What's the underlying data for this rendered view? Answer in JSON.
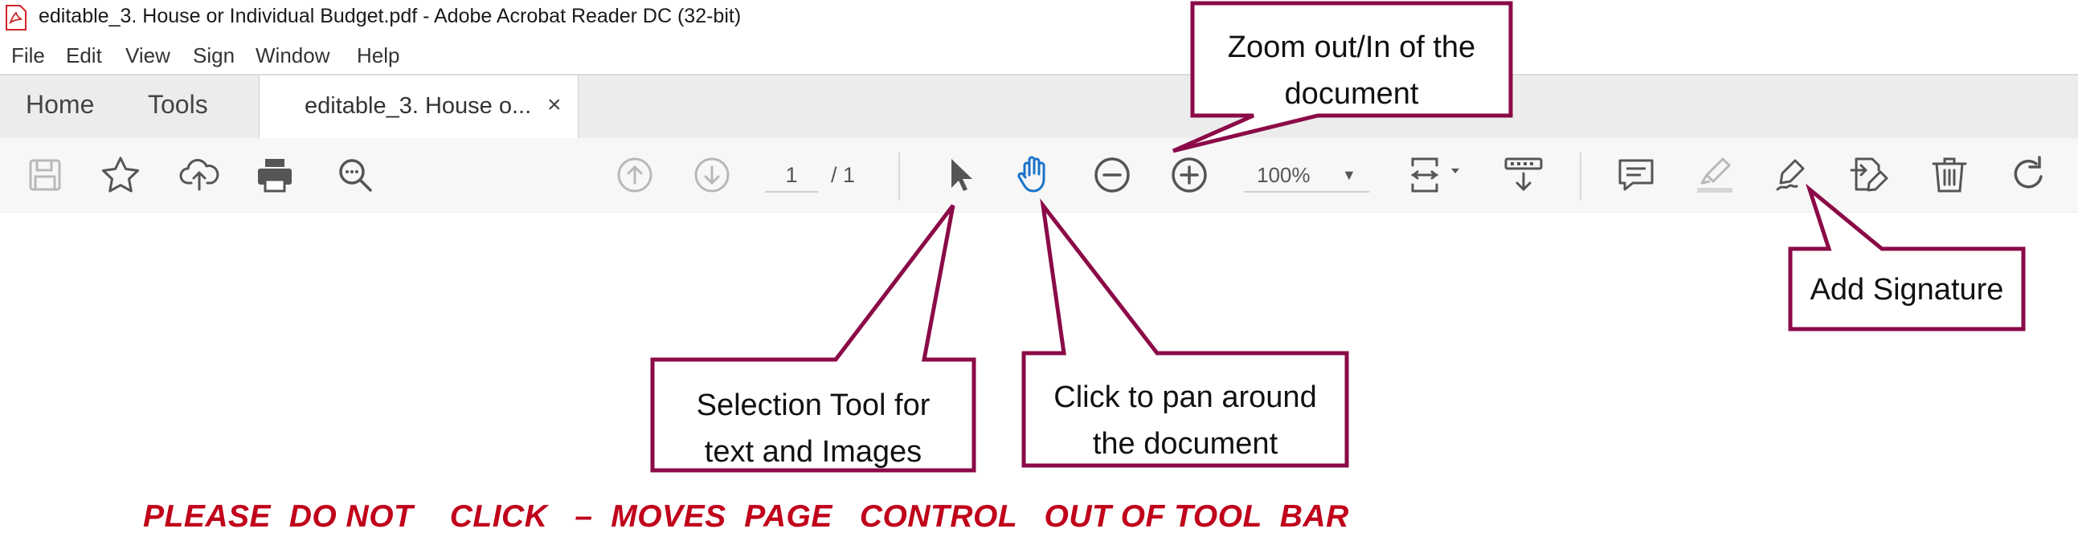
{
  "window": {
    "title": "editable_3. House or Individual Budget.pdf - Adobe Acrobat Reader DC (32-bit)"
  },
  "menu": [
    "File",
    "Edit",
    "View",
    "Sign",
    "Window",
    "Help"
  ],
  "tabs": {
    "home": "Home",
    "tools": "Tools",
    "document": "editable_3. House o...",
    "close": "×"
  },
  "toolbar": {
    "page_current": "1",
    "page_total": "/ 1",
    "zoom": "100%",
    "icons": [
      "save-icon",
      "bookmark-star-icon",
      "cloud-upload-icon",
      "print-icon",
      "search-zoom-icon",
      "page-up-icon",
      "page-down-icon",
      "select-cursor-icon",
      "hand-pan-icon",
      "zoom-out-icon",
      "zoom-in-icon",
      "fit-page-icon",
      "scroll-mode-icon",
      "comment-icon",
      "highlight-icon",
      "sign-pen-icon",
      "edit-pdf-icon",
      "delete-icon",
      "rotate-icon"
    ]
  },
  "callouts": {
    "zoom": [
      "Zoom out/In of the",
      "document"
    ],
    "selection": [
      "Selection Tool for",
      "text and Images"
    ],
    "pan": [
      "Click to pan around",
      "the document"
    ],
    "signature": [
      "Add Signature"
    ]
  },
  "warning": "PLEASE  DO NOT    CLICK   –  MOVES  PAGE   CONTROL   OUT OF TOOL  BAR",
  "colors": {
    "callout_border": "#8b0a47",
    "warning_text": "#c0001a",
    "hand_icon": "#1a73c8",
    "icon_gray": "#555555",
    "icon_disabled": "#b8b8b8"
  }
}
